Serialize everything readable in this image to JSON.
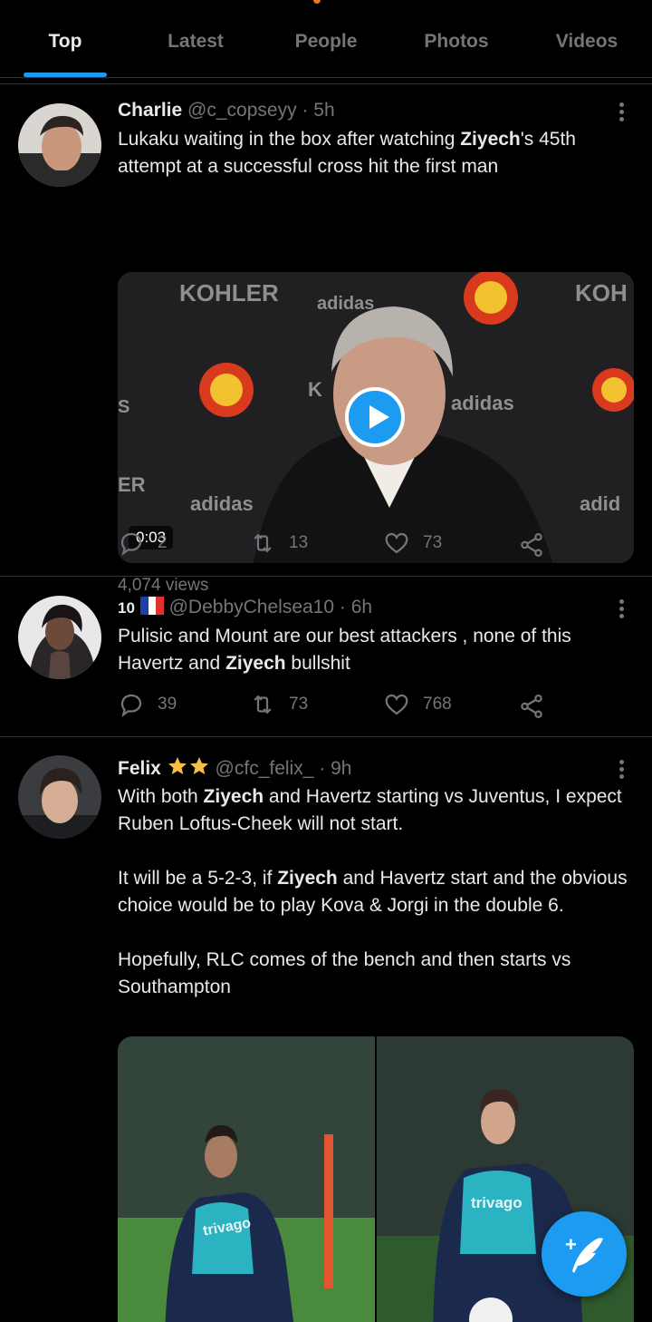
{
  "tabs": [
    {
      "label": "Top",
      "active": true
    },
    {
      "label": "Latest",
      "active": false
    },
    {
      "label": "People",
      "active": false
    },
    {
      "label": "Photos",
      "active": false
    },
    {
      "label": "Videos",
      "active": false
    }
  ],
  "tweets": [
    {
      "name": "Charlie",
      "handle": "@c_copseyy",
      "separator": "·",
      "time": "5h",
      "text_parts": [
        "Lukaku waiting in the box after watching ",
        "Ziyech",
        "'s 45th attempt at a successful cross hit the first man"
      ],
      "video": {
        "duration": "0:03",
        "sign_texts": [
          "KOHLER",
          "KOH",
          "adidas",
          "adidas",
          "adidas",
          "adid",
          "S",
          "ER",
          "K"
        ]
      },
      "views": "4,074 views",
      "replies": "2",
      "retweets": "13",
      "likes": "73"
    },
    {
      "name": "10",
      "handle": "@DebbyChelsea10",
      "separator": "·",
      "time": "6h",
      "text_parts": [
        "Pulisic and Mount are our best attackers , none of this Havertz and ",
        "Ziyech",
        " bullshit"
      ],
      "replies": "39",
      "retweets": "73",
      "likes": "768"
    },
    {
      "name": "Felix",
      "handle": "@cfc_felix_",
      "separator": "·",
      "time": "9h",
      "paragraphs": [
        [
          "With both ",
          "Ziyech",
          " and Havertz starting vs Juventus, I expect Ruben Loftus-Cheek will not start."
        ],
        [
          "It will be a 5-2-3, if ",
          "Ziyech",
          " and Havertz start and the obvious choice would be to play Kova & Jorgi in the double 6."
        ],
        [
          "Hopefully, RLC comes of the bench and then starts vs Southampton"
        ]
      ],
      "photo_shirt_texts": [
        "trivago",
        "trivago"
      ]
    }
  ],
  "colors": {
    "accent": "#1d9bf0",
    "muted": "#71767b",
    "text": "#e7e9ea",
    "star": "#f6c142"
  },
  "icons": [
    "reply-icon",
    "retweet-icon",
    "like-icon",
    "share-icon",
    "more-icon",
    "play-icon",
    "compose-icon",
    "star-icon",
    "flag-fr-icon"
  ]
}
